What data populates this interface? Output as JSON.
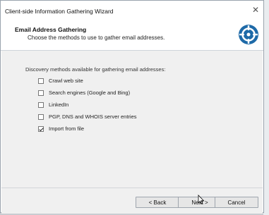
{
  "window": {
    "title": "Client-side Information Gathering Wizard",
    "close_glyph": "✕"
  },
  "header": {
    "title": "Email Address Gathering",
    "subtitle": "Choose the methods to use to gather email addresses.",
    "logo_icon": "target-crosshair-icon"
  },
  "content": {
    "label": "Discovery methods available for gathering email addresses:",
    "options": [
      {
        "label": "Crawl web site",
        "checked": false
      },
      {
        "label": "Search engines (Google and Bing)",
        "checked": false
      },
      {
        "label": "LinkedIn",
        "checked": false
      },
      {
        "label": "PGP, DNS and WHOIS server entries",
        "checked": false
      },
      {
        "label": "Import from file",
        "checked": true
      }
    ]
  },
  "buttons": {
    "back": "< Back",
    "next": "Next >",
    "cancel": "Cancel"
  },
  "colors": {
    "accent": "#1e6aa8",
    "content_bg": "#f0f0f0"
  }
}
